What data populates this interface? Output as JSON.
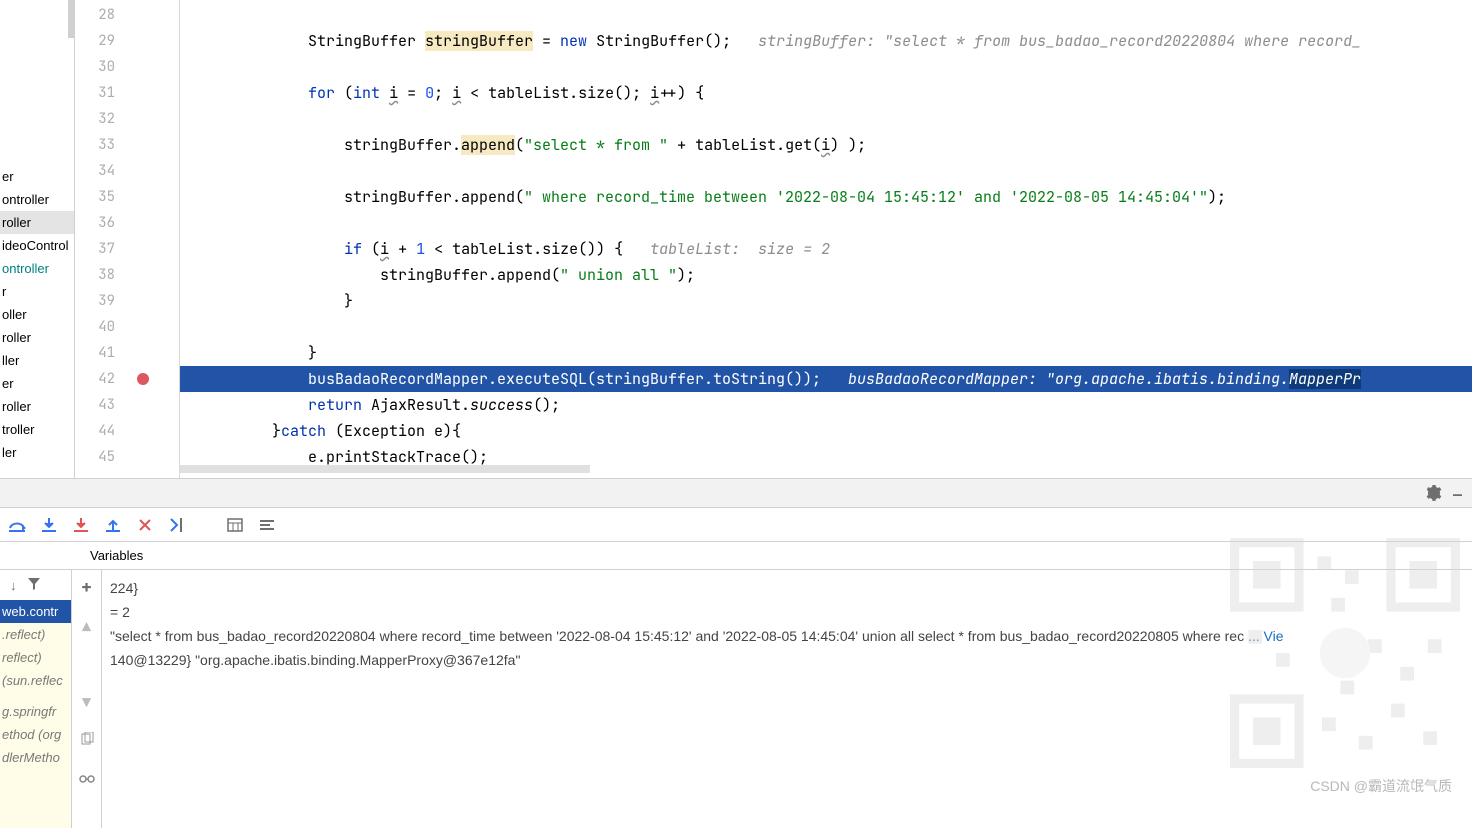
{
  "file_tree": {
    "items": [
      {
        "label": "er",
        "cls": ""
      },
      {
        "label": "ontroller",
        "cls": ""
      },
      {
        "label": "roller",
        "cls": "highlighted"
      },
      {
        "label": "ideoControl",
        "cls": ""
      },
      {
        "label": "ontroller",
        "cls": "teal"
      },
      {
        "label": "r",
        "cls": ""
      },
      {
        "label": "oller",
        "cls": ""
      },
      {
        "label": "roller",
        "cls": ""
      },
      {
        "label": "ller",
        "cls": ""
      },
      {
        "label": "er",
        "cls": ""
      },
      {
        "label": "roller",
        "cls": ""
      },
      {
        "label": "troller",
        "cls": ""
      },
      {
        "label": "ler",
        "cls": ""
      }
    ]
  },
  "gutter": {
    "start": 28,
    "end": 45,
    "breakpoint_line": 42
  },
  "code": {
    "lines": [
      {
        "n": 28,
        "html": ""
      },
      {
        "n": 29,
        "html": "            StringBuffer <span class='hl-yellow'>stringBuffer</span> = <span class='kw'>new</span> StringBuffer();   <span class='comment'>stringBuffer: \"select * from bus_badao_record20220804 where record_</span>"
      },
      {
        "n": 30,
        "html": ""
      },
      {
        "n": 31,
        "html": "            <span class='kw'>for</span> (<span class='kw'>int</span> <span class='wavy'>i</span> = <span class='num'>0</span>; <span class='wavy'>i</span> &lt; tableList.size(); <span class='wavy'>i</span>++) {"
      },
      {
        "n": 32,
        "html": ""
      },
      {
        "n": 33,
        "html": "                stringBuffer.<span class='hl-yellow'>append</span>(<span class='str'>\"select * from \"</span> + tableList.get(<span class='wavy'>i</span>) );"
      },
      {
        "n": 34,
        "html": ""
      },
      {
        "n": 35,
        "html": "                stringBuffer.append(<span class='str'>\" where record_time between '2022-08-04 15:45:12' and '2022-08-05 14:45:04'\"</span>);"
      },
      {
        "n": 36,
        "html": ""
      },
      {
        "n": 37,
        "html": "                <span class='kw'>if</span> (<span class='wavy'>i</span> + <span class='num'>1</span> &lt; tableList.size()) {   <span class='comment'>tableList:  size = 2</span>"
      },
      {
        "n": 38,
        "html": "                    stringBuffer.append(<span class='str'>\" union all \"</span>);"
      },
      {
        "n": 39,
        "html": "                }"
      },
      {
        "n": 40,
        "html": ""
      },
      {
        "n": 41,
        "html": "            }"
      },
      {
        "n": 42,
        "active": true,
        "html": "            busBadaoRecordMapper.executeSQL(stringBuffer.toString());   <span class='comment'>busBadaoRecordMapper: \"org.apache.ibatis.binding.</span><span class='comment' style='background:#0e3a7a'>MapperPr</span>"
      },
      {
        "n": 43,
        "html": "            <span class='kw'>return</span> AjaxResult.<span class='italic'>success</span>();"
      },
      {
        "n": 44,
        "html": "        }<span class='kw'>catch</span> (Exception e){"
      },
      {
        "n": 45,
        "html": "            e.printStackTrace();"
      }
    ]
  },
  "debug": {
    "variables_tab": "Variables",
    "frames": [
      {
        "label": "web.contr",
        "active": true
      },
      {
        "label": ".reflect)",
        "active": false
      },
      {
        "label": "reflect)",
        "active": false
      },
      {
        "label": "(sun.reflec",
        "active": false
      },
      {
        "label": "",
        "active": false
      },
      {
        "label": "g.springfr",
        "active": false
      },
      {
        "label": "ethod (org",
        "active": false
      },
      {
        "label": "dlerMetho",
        "active": false
      }
    ],
    "vars": [
      "224}",
      "= 2",
      "\"select * from bus_badao_record20220804 where record_time between '2022-08-04 15:45:12' and '2022-08-05 14:45:04' union all select * from bus_badao_record20220805 where rec",
      "140@13229} \"org.apache.ibatis.binding.MapperProxy@367e12fa\""
    ],
    "vars_link": "... Vie"
  },
  "watermark": {
    "text": "CSDN @霸道流氓气质"
  }
}
